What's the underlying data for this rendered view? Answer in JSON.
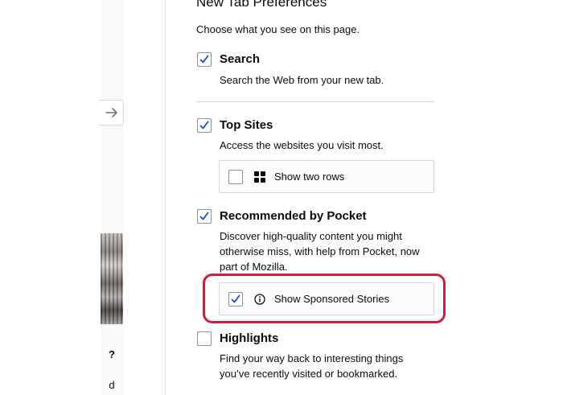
{
  "sidebar_peek": {
    "question_mark": "?",
    "letter_d": "d"
  },
  "preferences": {
    "title": "New Tab Preferences",
    "intro": "Choose what you see on this page.",
    "options": [
      {
        "label": "Search",
        "description": "Search the Web from your new tab.",
        "checked": true
      },
      {
        "label": "Top Sites",
        "description": "Access the websites you visit most.",
        "checked": true,
        "sub_option": {
          "label": "Show two rows",
          "checked": false,
          "icon": "grid-icon"
        }
      },
      {
        "label": "Recommended by Pocket",
        "description": "Discover high-quality content you might otherwise miss, with help from Pocket, now part of Mozilla.",
        "checked": true,
        "sub_option": {
          "label": "Show Sponsored Stories",
          "checked": true,
          "icon": "info-icon"
        }
      },
      {
        "label": "Highlights",
        "description": "Find your way back to interesting things you’ve recently visited or bookmarked.",
        "checked": false
      }
    ]
  },
  "colors": {
    "check_blue": "#0a84ff",
    "highlight_red": "#c9203b",
    "border_gray": "#d7d7db"
  }
}
